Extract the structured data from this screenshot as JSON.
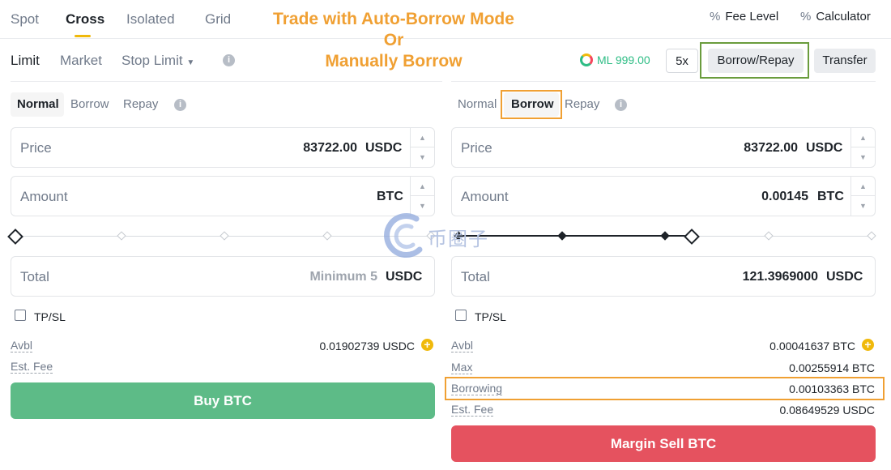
{
  "top_tabs": [
    "Spot",
    "Cross",
    "Isolated",
    "Grid"
  ],
  "annotation": {
    "line1": "Trade with Auto-Borrow Mode",
    "line2": "Or",
    "line3": "Manually Borrow"
  },
  "toolbar": {
    "fee_level": "Fee Level",
    "calculator": "Calculator"
  },
  "order_types": {
    "limit": "Limit",
    "market": "Market",
    "stop_limit": "Stop Limit"
  },
  "margin_level": "ML 999.00",
  "leverage": "5x",
  "borrow_repay": "Borrow/Repay",
  "transfer": "Transfer",
  "watermark": "币圈子",
  "buy_panel": {
    "modes": [
      "Normal",
      "Borrow",
      "Repay"
    ],
    "price_label": "Price",
    "price_value": "83722.00",
    "price_unit": "USDC",
    "amount_label": "Amount",
    "amount_value": "",
    "amount_unit": "BTC",
    "total_label": "Total",
    "total_placeholder": "Minimum 5",
    "total_unit": "USDC",
    "tpsl": "TP/SL",
    "avbl_label": "Avbl",
    "avbl_value": "0.01902739 USDC",
    "fee_label": "Est. Fee",
    "button": "Buy BTC"
  },
  "sell_panel": {
    "modes": [
      "Normal",
      "Borrow",
      "Repay"
    ],
    "price_label": "Price",
    "price_value": "83722.00",
    "price_unit": "USDC",
    "amount_label": "Amount",
    "amount_value": "0.00145",
    "amount_unit": "BTC",
    "total_label": "Total",
    "total_value": "121.3969000",
    "total_unit": "USDC",
    "tpsl": "TP/SL",
    "avbl_label": "Avbl",
    "avbl_value": "0.00041637 BTC",
    "max_label": "Max",
    "max_value": "0.00255914 BTC",
    "borrowing_label": "Borrowing",
    "borrowing_value": "0.00103363 BTC",
    "fee_label": "Est. Fee",
    "fee_value": "0.08649529 USDC",
    "button": "Margin Sell BTC",
    "slider_percent": 75
  },
  "colors": {
    "buy": "#5dbb87",
    "sell": "#e5525f",
    "accent": "#f0b90b",
    "annotation": "#f0a033",
    "highlight_green": "#6a9c3d"
  },
  "icons": [
    "fee-level-icon",
    "calculator-icon",
    "info-icon",
    "gauge-icon",
    "plus-circle-icon",
    "chevron-down-icon"
  ]
}
